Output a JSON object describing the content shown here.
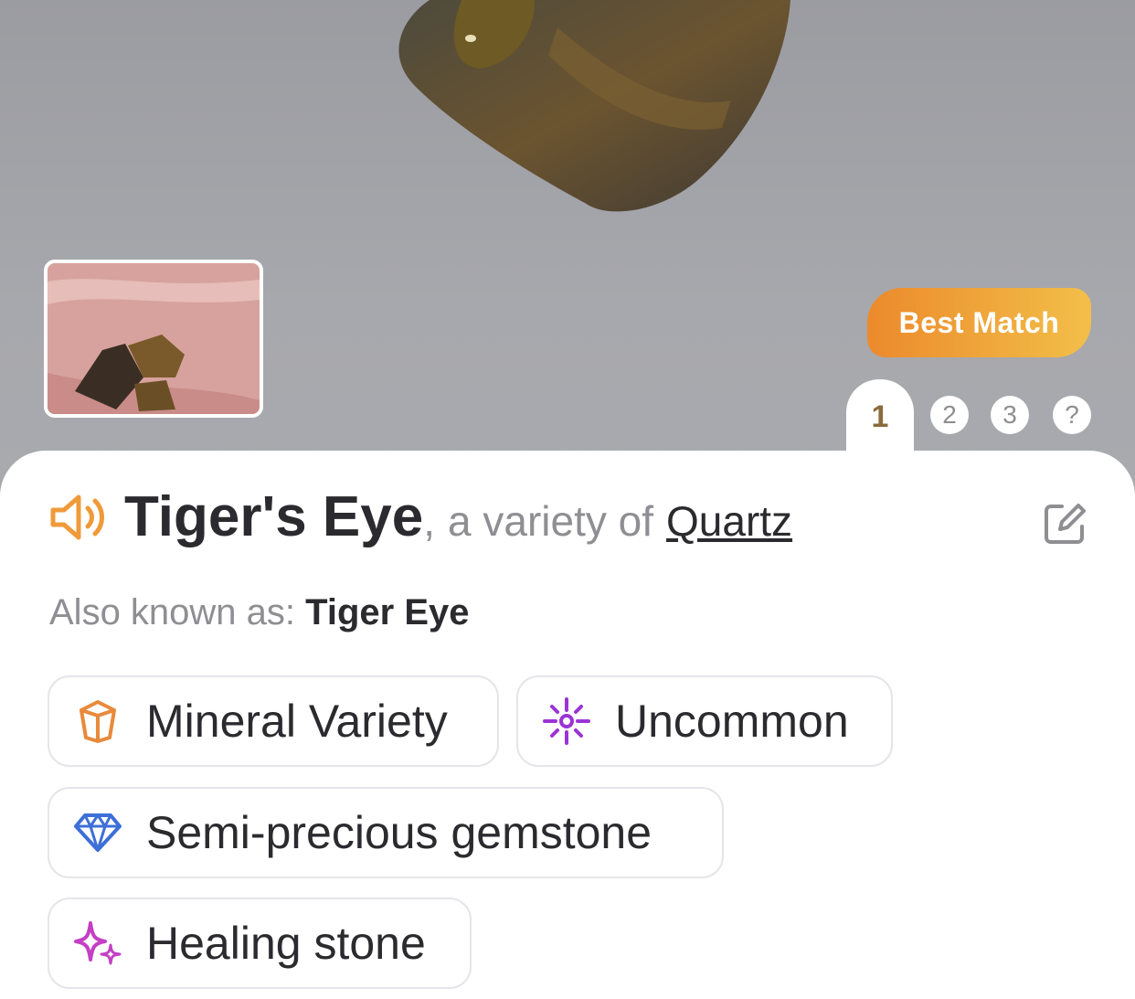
{
  "badge": {
    "label": "Best Match"
  },
  "tabs": {
    "active": "1",
    "items": [
      "2",
      "3",
      "?"
    ]
  },
  "title": {
    "name": "Tiger's Eye",
    "separator": ",",
    "variety_text": "a variety of",
    "parent": "Quartz"
  },
  "aka": {
    "label": "Also known as:",
    "value": "Tiger Eye"
  },
  "chips": [
    {
      "label": "Mineral Variety",
      "icon": "crystal-icon",
      "color": "#e88a3c"
    },
    {
      "label": "Uncommon",
      "icon": "sparkle-burst-icon",
      "color": "#9b34d6"
    },
    {
      "label": "Semi-precious gemstone",
      "icon": "diamond-icon",
      "color": "#3d6fd8"
    },
    {
      "label": "Healing stone",
      "icon": "sparkles-icon",
      "color": "#c43fc4"
    }
  ],
  "colors": {
    "accent": "#ef9a3a",
    "tab_active_text": "#8b6b3c"
  }
}
